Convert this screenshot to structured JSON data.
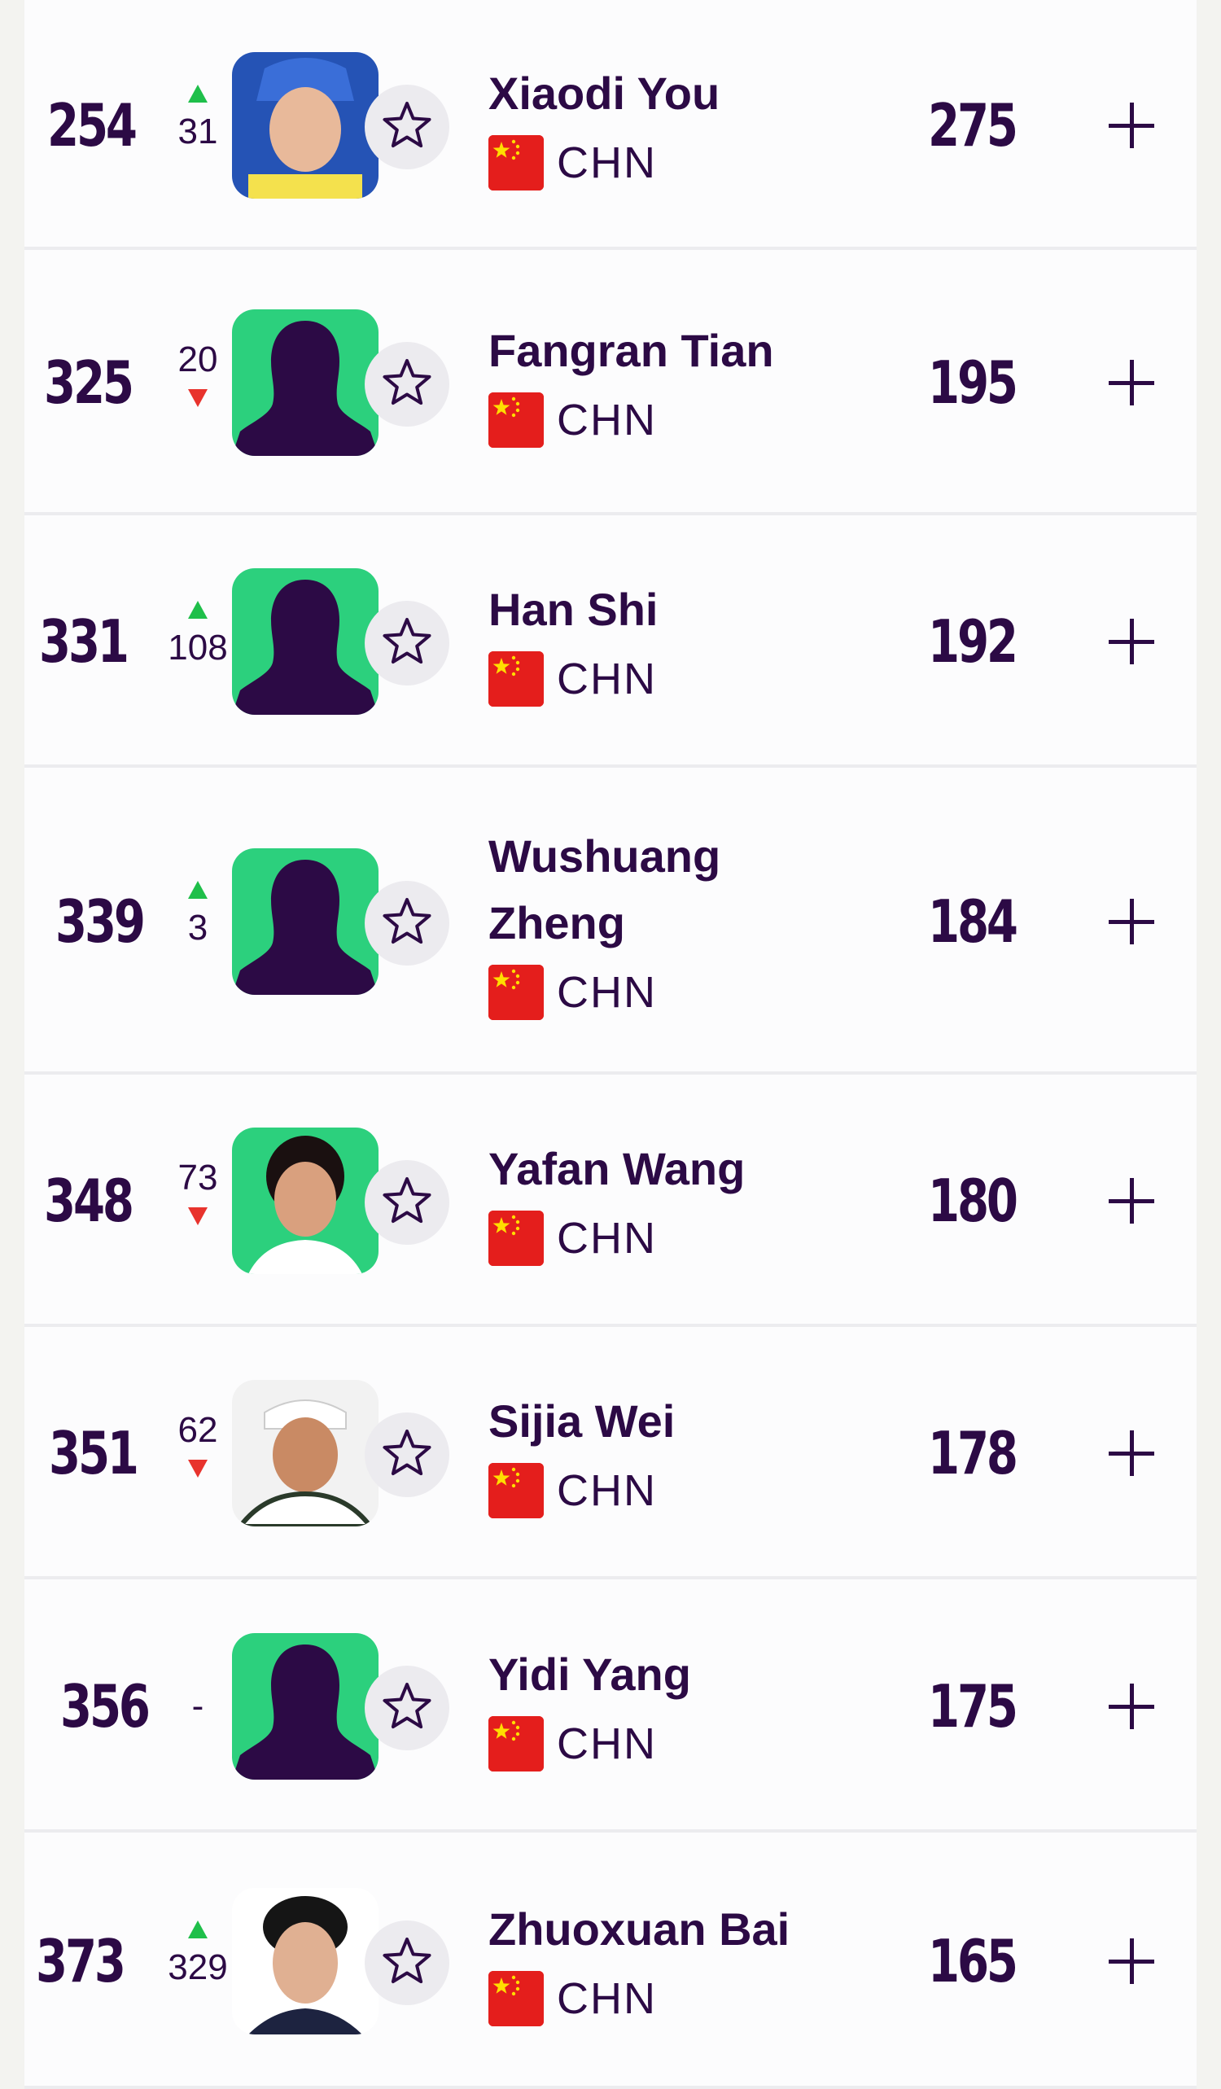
{
  "colors": {
    "text": "#2c0a45",
    "up": "#1fbf4a",
    "down": "#e8332d",
    "avatar_bg": "#2cd07d",
    "row_divider": "#ececef"
  },
  "players": [
    {
      "rank": "254",
      "move_dir": "up",
      "move": "31",
      "name": "Xiaodi You",
      "country": "CHN",
      "points": "275",
      "avatar": "photo-blue"
    },
    {
      "rank": "325",
      "move_dir": "down",
      "move": "20",
      "name": "Fangran Tian",
      "country": "CHN",
      "points": "195",
      "avatar": "silhouette"
    },
    {
      "rank": "331",
      "move_dir": "up",
      "move": "108",
      "name": "Han Shi",
      "country": "CHN",
      "points": "192",
      "avatar": "silhouette"
    },
    {
      "rank": "339",
      "move_dir": "up",
      "move": "3",
      "name": "Wushuang Zheng",
      "country": "CHN",
      "points": "184",
      "avatar": "silhouette"
    },
    {
      "rank": "348",
      "move_dir": "down",
      "move": "73",
      "name": "Yafan Wang",
      "country": "CHN",
      "points": "180",
      "avatar": "photo-green"
    },
    {
      "rank": "351",
      "move_dir": "down",
      "move": "62",
      "name": "Sijia Wei",
      "country": "CHN",
      "points": "178",
      "avatar": "photo-white"
    },
    {
      "rank": "356",
      "move_dir": "none",
      "move": "-",
      "name": "Yidi Yang",
      "country": "CHN",
      "points": "175",
      "avatar": "silhouette"
    },
    {
      "rank": "373",
      "move_dir": "up",
      "move": "329",
      "name": "Zhuoxuan Bai",
      "country": "CHN",
      "points": "165",
      "avatar": "photo-white2"
    }
  ]
}
